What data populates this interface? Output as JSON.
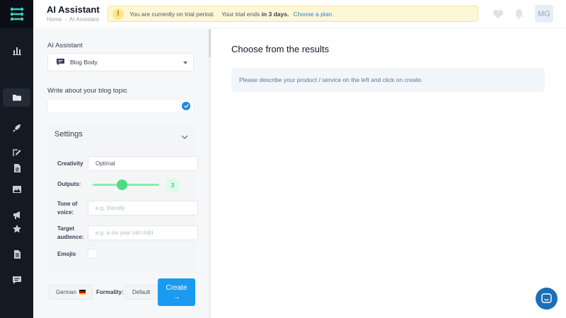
{
  "header": {
    "title": "AI Assistant",
    "breadcrumb": [
      "Home",
      "AI Assistant"
    ],
    "trial": {
      "prefix": "You are currently on trial period.",
      "ends": "Your trial ends",
      "duration": "in 3 days.",
      "link": "Choose a plan."
    },
    "avatar": "MG"
  },
  "sidebar": {
    "icons": [
      "stats-icon",
      "folder-icon",
      "rocket-icon",
      "edit-icon",
      "document-icon",
      "image-icon",
      "megaphone-icon",
      "star-icon",
      "list-document-icon",
      "message-icon"
    ]
  },
  "form": {
    "assistant_label": "AI Assistant",
    "assistant_value": "Blog Body",
    "topic_label": "Write about your blog topic",
    "topic_value": "",
    "settings": {
      "title": "Settings",
      "creativity_label": "Creativity",
      "creativity_value": "Optimal",
      "outputs_label": "Outputs:",
      "outputs_value": "3",
      "tone_label": "Tone of voice:",
      "tone_placeholder": "e.g. friendly",
      "audience_label": "Target audience:",
      "audience_placeholder": "e.g. a six year old child",
      "emojis_label": "Emojis"
    },
    "language": "German",
    "formality_label": "Formality:",
    "formality_value": "Default",
    "create_label": "Create",
    "create_arrow": "→"
  },
  "results": {
    "title": "Choose from the results",
    "placeholder": "Please describe your product / service on the left and click on create."
  },
  "colors": {
    "accent": "#1a9bf0",
    "sidebar": "#141a23",
    "slider": "#4ade80",
    "trial_bg": "#fef7d6"
  }
}
